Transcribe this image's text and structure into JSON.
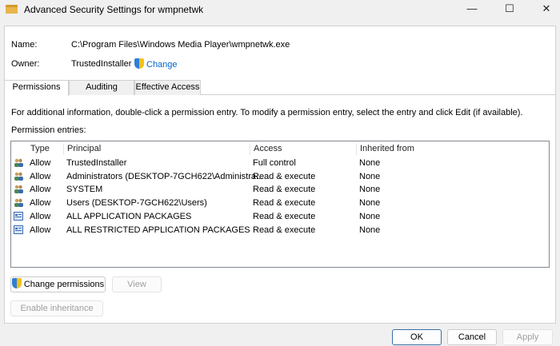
{
  "window": {
    "title": "Advanced Security Settings for wmpnetwk",
    "minimize": "—",
    "maximize": "☐",
    "close": "✕"
  },
  "name_label": "Name:",
  "name_value": "C:\\Program Files\\Windows Media Player\\wmpnetwk.exe",
  "owner_label": "Owner:",
  "owner_value": "TrustedInstaller",
  "change_link": "Change",
  "tabs": [
    {
      "label": "Permissions"
    },
    {
      "label": "Auditing"
    },
    {
      "label": "Effective Access"
    }
  ],
  "info_text": "For additional information, double-click a permission entry. To modify a permission entry, select the entry and click Edit (if available).",
  "entries_label": "Permission entries:",
  "columns": [
    "Type",
    "Principal",
    "Access",
    "Inherited from"
  ],
  "rows": [
    {
      "icon": "users-icon",
      "type": "Allow",
      "principal": "TrustedInstaller",
      "access": "Full control",
      "inherited": "None"
    },
    {
      "icon": "users-icon",
      "type": "Allow",
      "principal": "Administrators (DESKTOP-7GCH622\\Administra...",
      "access": "Read & execute",
      "inherited": "None"
    },
    {
      "icon": "users-icon",
      "type": "Allow",
      "principal": "SYSTEM",
      "access": "Read & execute",
      "inherited": "None"
    },
    {
      "icon": "users-icon",
      "type": "Allow",
      "principal": "Users (DESKTOP-7GCH622\\Users)",
      "access": "Read & execute",
      "inherited": "None"
    },
    {
      "icon": "app-package-icon",
      "type": "Allow",
      "principal": "ALL APPLICATION PACKAGES",
      "access": "Read & execute",
      "inherited": "None"
    },
    {
      "icon": "app-package-icon",
      "type": "Allow",
      "principal": "ALL RESTRICTED APPLICATION PACKAGES",
      "access": "Read & execute",
      "inherited": "None"
    }
  ],
  "buttons": {
    "change_permissions": "Change permissions",
    "view": "View",
    "enable_inheritance": "Enable inheritance",
    "ok": "OK",
    "cancel": "Cancel",
    "apply": "Apply"
  },
  "colors": {
    "link": "#0066cc"
  }
}
